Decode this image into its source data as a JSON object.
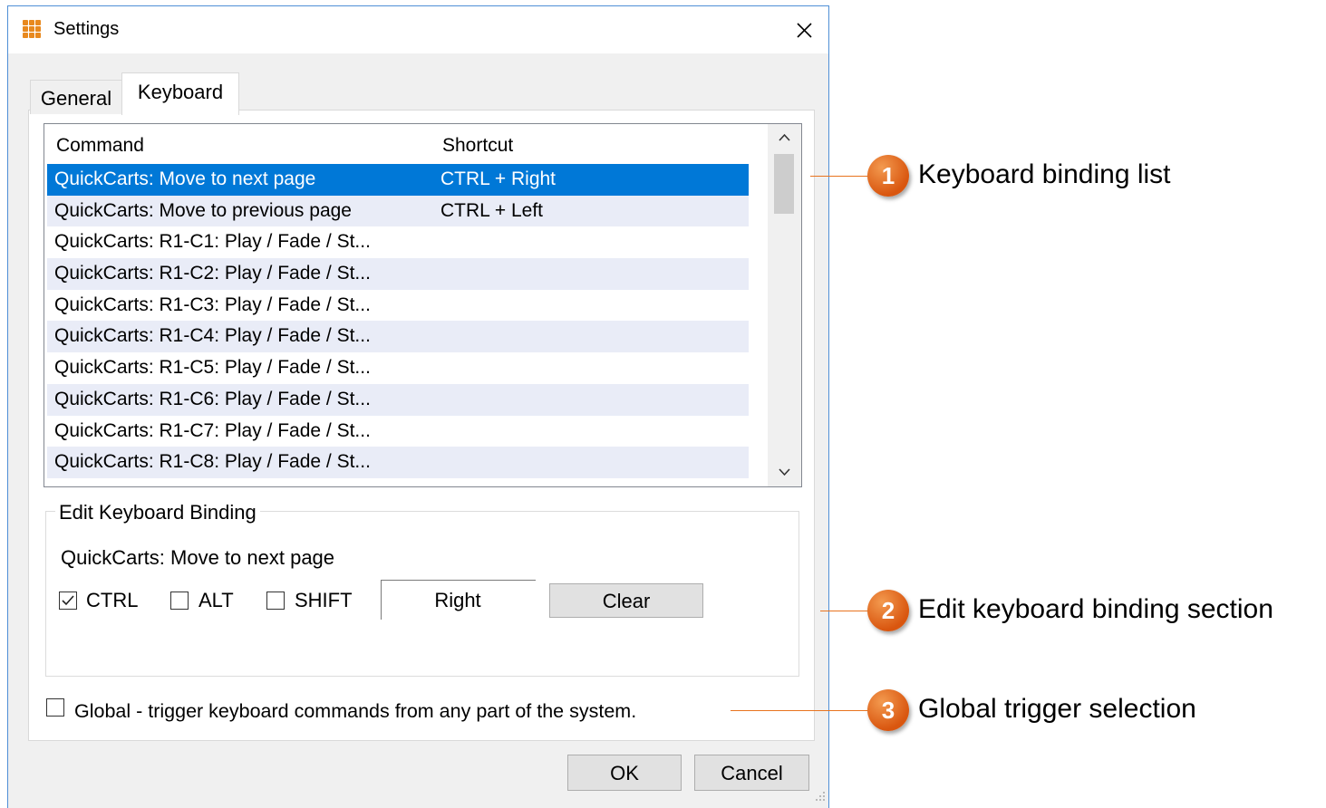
{
  "window": {
    "title": "Settings"
  },
  "tabs": [
    {
      "label": "General",
      "active": false
    },
    {
      "label": "Keyboard",
      "active": true
    }
  ],
  "list": {
    "headers": {
      "command": "Command",
      "shortcut": "Shortcut"
    },
    "rows": [
      {
        "command": "QuickCarts: Move to next page",
        "shortcut": "CTRL + Right",
        "selected": true
      },
      {
        "command": "QuickCarts: Move to previous page",
        "shortcut": "CTRL + Left"
      },
      {
        "command": "QuickCarts: R1-C1: Play / Fade / St...",
        "shortcut": ""
      },
      {
        "command": "QuickCarts: R1-C2: Play / Fade / St...",
        "shortcut": ""
      },
      {
        "command": "QuickCarts: R1-C3: Play / Fade / St...",
        "shortcut": ""
      },
      {
        "command": "QuickCarts: R1-C4: Play / Fade / St...",
        "shortcut": ""
      },
      {
        "command": "QuickCarts: R1-C5: Play / Fade / St...",
        "shortcut": ""
      },
      {
        "command": "QuickCarts: R1-C6: Play / Fade / St...",
        "shortcut": ""
      },
      {
        "command": "QuickCarts: R1-C7: Play / Fade / St...",
        "shortcut": ""
      },
      {
        "command": "QuickCarts: R1-C8: Play / Fade / St...",
        "shortcut": ""
      }
    ]
  },
  "edit_binding": {
    "group_label": "Edit Keyboard Binding",
    "command": "QuickCarts: Move to next page",
    "modifiers": [
      {
        "label": "CTRL",
        "checked": true
      },
      {
        "label": "ALT",
        "checked": false
      },
      {
        "label": "SHIFT",
        "checked": false
      }
    ],
    "key_value": "Right",
    "clear_label": "Clear"
  },
  "global": {
    "label": "Global - trigger keyboard commands from any part of the system.",
    "checked": false
  },
  "buttons": {
    "ok": "OK",
    "cancel": "Cancel"
  },
  "callouts": [
    {
      "number": "1",
      "text": "Keyboard binding list"
    },
    {
      "number": "2",
      "text": "Edit keyboard binding section"
    },
    {
      "number": "3",
      "text": "Global trigger selection"
    }
  ],
  "colors": {
    "selection": "#0078d7",
    "callout": "#e4661c",
    "window_border": "#4f8fd6"
  }
}
